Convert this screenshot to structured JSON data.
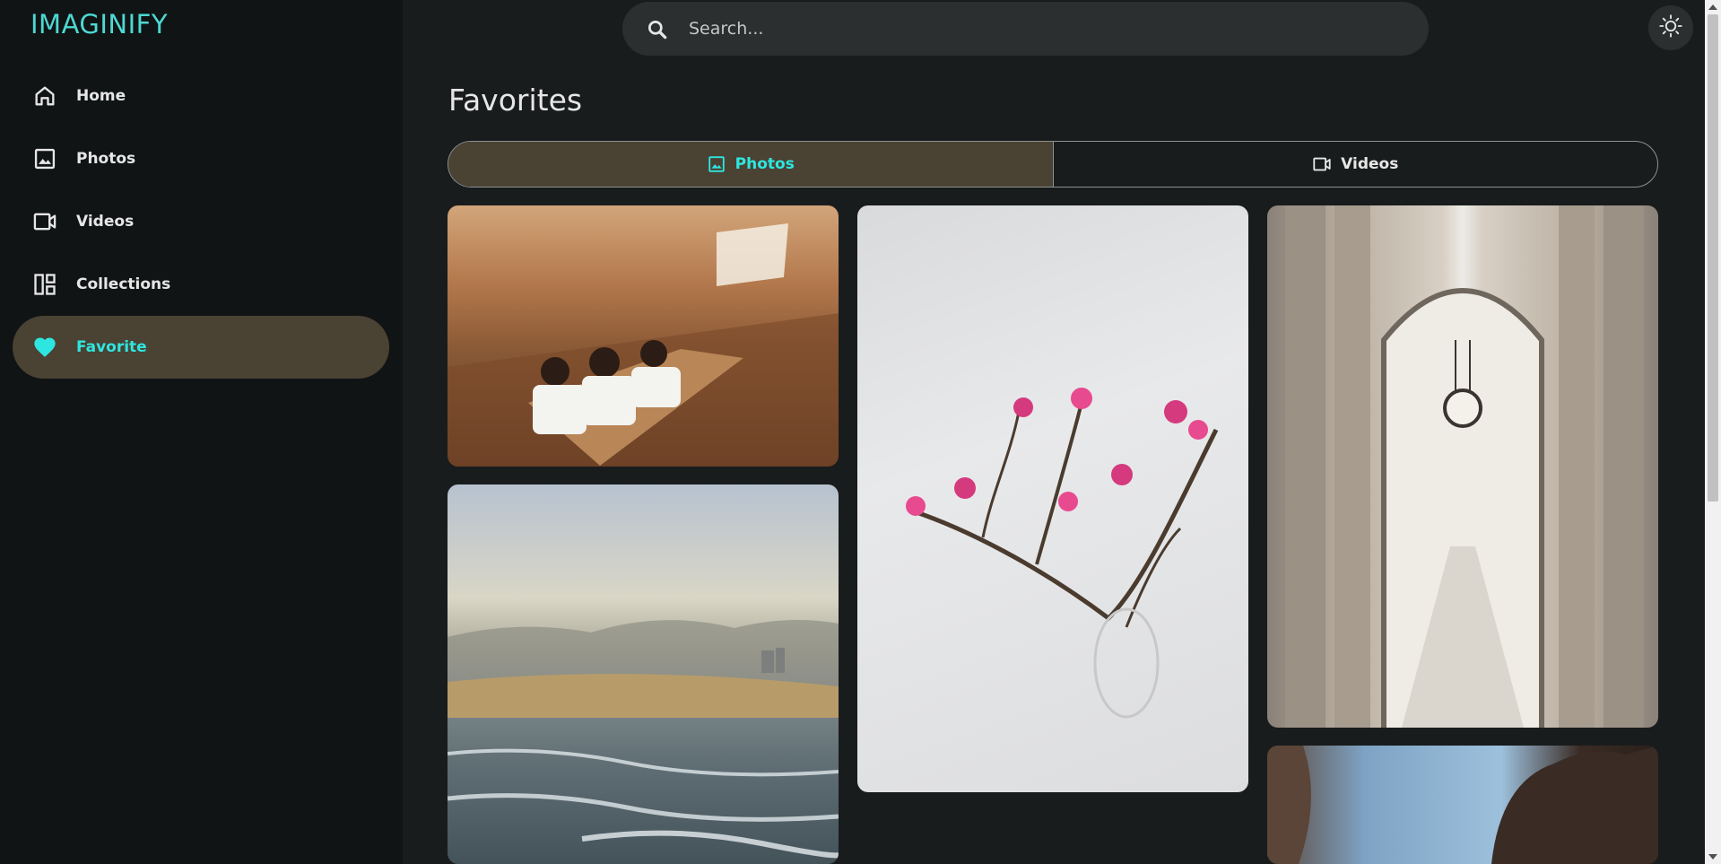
{
  "app": {
    "logo": "IMAGINIFY"
  },
  "sidebar": {
    "items": [
      {
        "label": "Home",
        "icon": "home-icon",
        "active": false
      },
      {
        "label": "Photos",
        "icon": "photo-icon",
        "active": false
      },
      {
        "label": "Videos",
        "icon": "video-icon",
        "active": false
      },
      {
        "label": "Collections",
        "icon": "collections-icon",
        "active": false
      },
      {
        "label": "Favorite",
        "icon": "heart-icon",
        "active": true
      }
    ]
  },
  "search": {
    "placeholder": "Search..."
  },
  "header": {
    "theme_icon": "sun-icon"
  },
  "main": {
    "title": "Favorites",
    "tabs": [
      {
        "label": "Photos",
        "icon": "photo-icon",
        "active": true
      },
      {
        "label": "Videos",
        "icon": "video-icon",
        "active": false
      }
    ],
    "photos": [
      {
        "subject": "classroom"
      },
      {
        "subject": "magnolia-branch"
      },
      {
        "subject": "colonnade"
      },
      {
        "subject": "beach"
      },
      {
        "subject": "rocks-sky"
      }
    ]
  },
  "colors": {
    "accent": "#2ee6e0",
    "logo": "#4dd9d3",
    "active_bg": "#4a4233",
    "sidebar_bg": "#111415",
    "main_bg": "#191c1d"
  }
}
